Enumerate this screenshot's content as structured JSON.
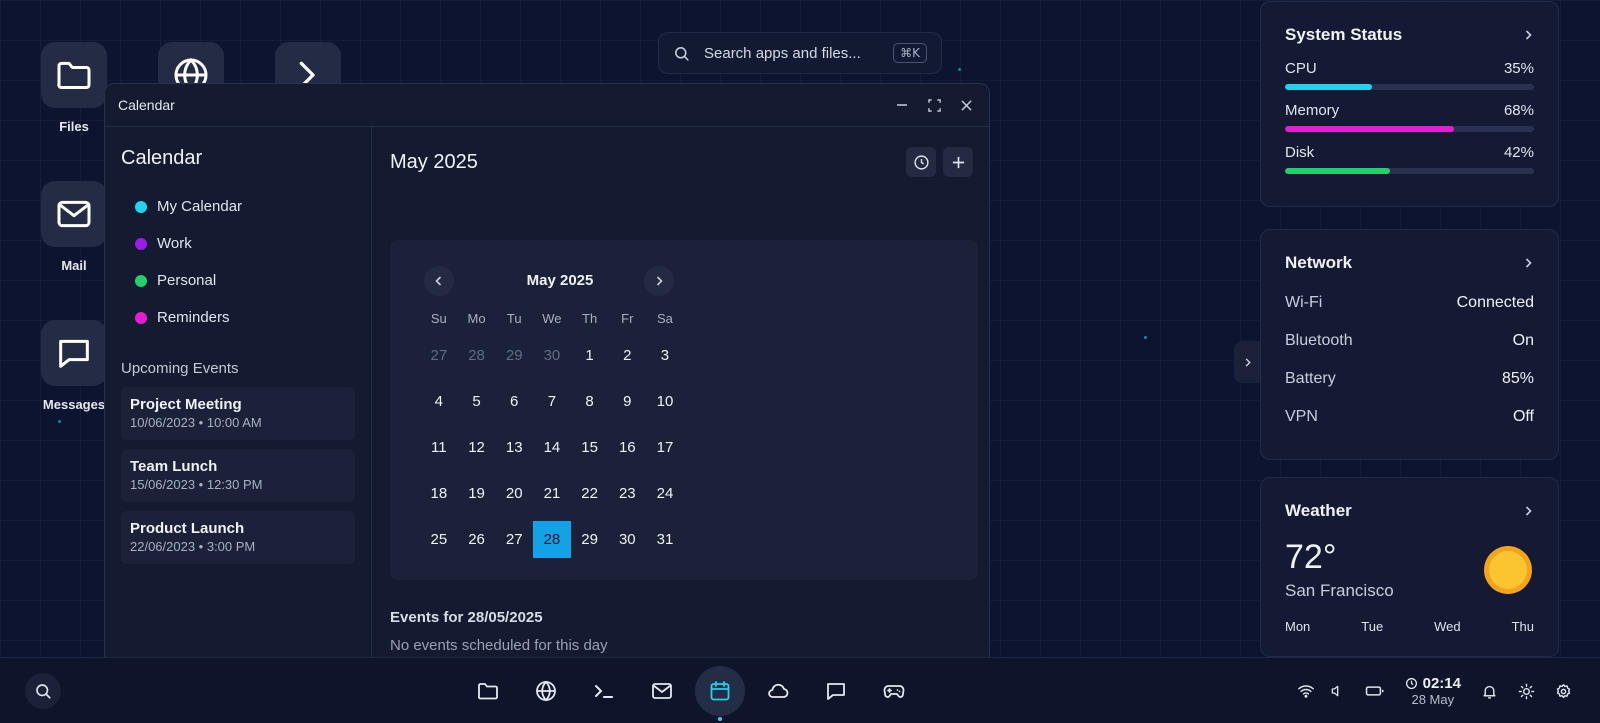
{
  "desktop": {
    "icons": [
      {
        "label": "Files",
        "icon": "folder-icon"
      },
      {
        "label": "",
        "icon": "globe-icon"
      },
      {
        "label": "",
        "icon": "terminal-icon"
      },
      {
        "label": "Mail",
        "icon": "mail-icon"
      },
      {
        "label": "Messages",
        "icon": "message-icon"
      }
    ]
  },
  "search": {
    "text": "Search apps and files...",
    "shortcut": "⌘K"
  },
  "window": {
    "title": "Calendar",
    "sidebar": {
      "heading": "Calendar",
      "calendars": [
        {
          "label": "My Calendar",
          "color": "#22d3ee"
        },
        {
          "label": "Work",
          "color": "#9b1ce6"
        },
        {
          "label": "Personal",
          "color": "#21d06a"
        },
        {
          "label": "Reminders",
          "color": "#e81bd5"
        }
      ],
      "upcoming_heading": "Upcoming Events",
      "events": [
        {
          "name": "Project Meeting",
          "when": "10/06/2023 • 10:00 AM"
        },
        {
          "name": "Team Lunch",
          "when": "15/06/2023 • 12:30 PM"
        },
        {
          "name": "Product Launch",
          "when": "22/06/2023 • 3:00 PM"
        }
      ]
    },
    "main": {
      "heading": "May 2025",
      "picker_month": "May 2025",
      "weekdays": [
        "Su",
        "Mo",
        "Tu",
        "We",
        "Th",
        "Fr",
        "Sa"
      ],
      "weeks": [
        [
          "27",
          "28",
          "29",
          "30",
          "1",
          "2",
          "3"
        ],
        [
          "4",
          "5",
          "6",
          "7",
          "8",
          "9",
          "10"
        ],
        [
          "11",
          "12",
          "13",
          "14",
          "15",
          "16",
          "17"
        ],
        [
          "18",
          "19",
          "20",
          "21",
          "22",
          "23",
          "24"
        ],
        [
          "25",
          "26",
          "27",
          "28",
          "29",
          "30",
          "31"
        ]
      ],
      "muted_days_first_week": 4,
      "selected_day": "28",
      "events_for": "Events for 28/05/2025",
      "no_events": "No events scheduled for this day"
    }
  },
  "widgets": {
    "system": {
      "title": "System Status",
      "stats": [
        {
          "label": "CPU",
          "value": "35%",
          "percent": 35,
          "color": "#22d3ee"
        },
        {
          "label": "Memory",
          "value": "68%",
          "percent": 68,
          "color": "#e81bd5"
        },
        {
          "label": "Disk",
          "value": "42%",
          "percent": 42,
          "color": "#21d06a"
        }
      ]
    },
    "network": {
      "title": "Network",
      "rows": [
        {
          "label": "Wi-Fi",
          "value": "Connected"
        },
        {
          "label": "Bluetooth",
          "value": "On"
        },
        {
          "label": "Battery",
          "value": "85%"
        },
        {
          "label": "VPN",
          "value": "Off"
        }
      ]
    },
    "weather": {
      "title": "Weather",
      "temp": "72°",
      "city": "San Francisco",
      "days": [
        "Mon",
        "Tue",
        "Wed",
        "Thu"
      ]
    }
  },
  "taskbar": {
    "apps": [
      "folder-icon",
      "globe-icon",
      "terminal-icon",
      "mail-icon",
      "calendar-icon",
      "cloud-icon",
      "message-icon",
      "gamepad-icon"
    ],
    "active_app": "calendar-icon",
    "time": "02:14",
    "date": "28 May"
  }
}
